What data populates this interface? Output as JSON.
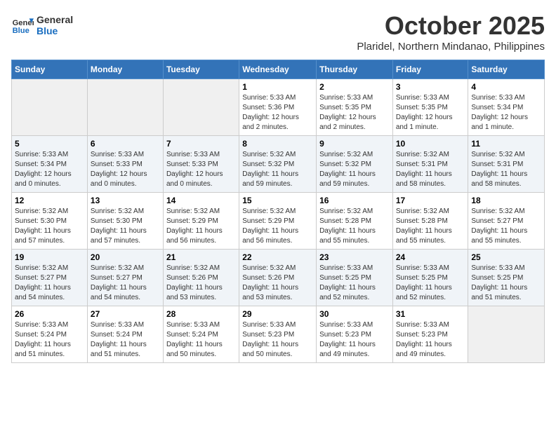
{
  "logo": {
    "line1": "General",
    "line2": "Blue"
  },
  "title": "October 2025",
  "location": "Plaridel, Northern Mindanao, Philippines",
  "days_of_week": [
    "Sunday",
    "Monday",
    "Tuesday",
    "Wednesday",
    "Thursday",
    "Friday",
    "Saturday"
  ],
  "weeks": [
    [
      {
        "day": "",
        "info": ""
      },
      {
        "day": "",
        "info": ""
      },
      {
        "day": "",
        "info": ""
      },
      {
        "day": "1",
        "info": "Sunrise: 5:33 AM\nSunset: 5:36 PM\nDaylight: 12 hours\nand 2 minutes."
      },
      {
        "day": "2",
        "info": "Sunrise: 5:33 AM\nSunset: 5:35 PM\nDaylight: 12 hours\nand 2 minutes."
      },
      {
        "day": "3",
        "info": "Sunrise: 5:33 AM\nSunset: 5:35 PM\nDaylight: 12 hours\nand 1 minute."
      },
      {
        "day": "4",
        "info": "Sunrise: 5:33 AM\nSunset: 5:34 PM\nDaylight: 12 hours\nand 1 minute."
      }
    ],
    [
      {
        "day": "5",
        "info": "Sunrise: 5:33 AM\nSunset: 5:34 PM\nDaylight: 12 hours\nand 0 minutes."
      },
      {
        "day": "6",
        "info": "Sunrise: 5:33 AM\nSunset: 5:33 PM\nDaylight: 12 hours\nand 0 minutes."
      },
      {
        "day": "7",
        "info": "Sunrise: 5:33 AM\nSunset: 5:33 PM\nDaylight: 12 hours\nand 0 minutes."
      },
      {
        "day": "8",
        "info": "Sunrise: 5:32 AM\nSunset: 5:32 PM\nDaylight: 11 hours\nand 59 minutes."
      },
      {
        "day": "9",
        "info": "Sunrise: 5:32 AM\nSunset: 5:32 PM\nDaylight: 11 hours\nand 59 minutes."
      },
      {
        "day": "10",
        "info": "Sunrise: 5:32 AM\nSunset: 5:31 PM\nDaylight: 11 hours\nand 58 minutes."
      },
      {
        "day": "11",
        "info": "Sunrise: 5:32 AM\nSunset: 5:31 PM\nDaylight: 11 hours\nand 58 minutes."
      }
    ],
    [
      {
        "day": "12",
        "info": "Sunrise: 5:32 AM\nSunset: 5:30 PM\nDaylight: 11 hours\nand 57 minutes."
      },
      {
        "day": "13",
        "info": "Sunrise: 5:32 AM\nSunset: 5:30 PM\nDaylight: 11 hours\nand 57 minutes."
      },
      {
        "day": "14",
        "info": "Sunrise: 5:32 AM\nSunset: 5:29 PM\nDaylight: 11 hours\nand 56 minutes."
      },
      {
        "day": "15",
        "info": "Sunrise: 5:32 AM\nSunset: 5:29 PM\nDaylight: 11 hours\nand 56 minutes."
      },
      {
        "day": "16",
        "info": "Sunrise: 5:32 AM\nSunset: 5:28 PM\nDaylight: 11 hours\nand 55 minutes."
      },
      {
        "day": "17",
        "info": "Sunrise: 5:32 AM\nSunset: 5:28 PM\nDaylight: 11 hours\nand 55 minutes."
      },
      {
        "day": "18",
        "info": "Sunrise: 5:32 AM\nSunset: 5:27 PM\nDaylight: 11 hours\nand 55 minutes."
      }
    ],
    [
      {
        "day": "19",
        "info": "Sunrise: 5:32 AM\nSunset: 5:27 PM\nDaylight: 11 hours\nand 54 minutes."
      },
      {
        "day": "20",
        "info": "Sunrise: 5:32 AM\nSunset: 5:27 PM\nDaylight: 11 hours\nand 54 minutes."
      },
      {
        "day": "21",
        "info": "Sunrise: 5:32 AM\nSunset: 5:26 PM\nDaylight: 11 hours\nand 53 minutes."
      },
      {
        "day": "22",
        "info": "Sunrise: 5:32 AM\nSunset: 5:26 PM\nDaylight: 11 hours\nand 53 minutes."
      },
      {
        "day": "23",
        "info": "Sunrise: 5:33 AM\nSunset: 5:25 PM\nDaylight: 11 hours\nand 52 minutes."
      },
      {
        "day": "24",
        "info": "Sunrise: 5:33 AM\nSunset: 5:25 PM\nDaylight: 11 hours\nand 52 minutes."
      },
      {
        "day": "25",
        "info": "Sunrise: 5:33 AM\nSunset: 5:25 PM\nDaylight: 11 hours\nand 51 minutes."
      }
    ],
    [
      {
        "day": "26",
        "info": "Sunrise: 5:33 AM\nSunset: 5:24 PM\nDaylight: 11 hours\nand 51 minutes."
      },
      {
        "day": "27",
        "info": "Sunrise: 5:33 AM\nSunset: 5:24 PM\nDaylight: 11 hours\nand 51 minutes."
      },
      {
        "day": "28",
        "info": "Sunrise: 5:33 AM\nSunset: 5:24 PM\nDaylight: 11 hours\nand 50 minutes."
      },
      {
        "day": "29",
        "info": "Sunrise: 5:33 AM\nSunset: 5:23 PM\nDaylight: 11 hours\nand 50 minutes."
      },
      {
        "day": "30",
        "info": "Sunrise: 5:33 AM\nSunset: 5:23 PM\nDaylight: 11 hours\nand 49 minutes."
      },
      {
        "day": "31",
        "info": "Sunrise: 5:33 AM\nSunset: 5:23 PM\nDaylight: 11 hours\nand 49 minutes."
      },
      {
        "day": "",
        "info": ""
      }
    ]
  ]
}
